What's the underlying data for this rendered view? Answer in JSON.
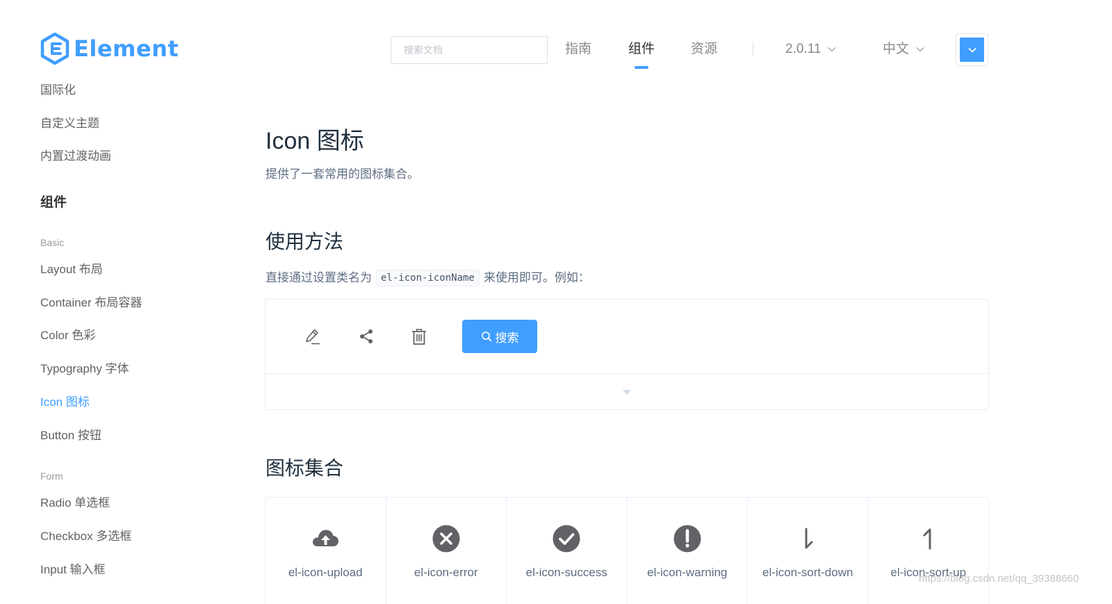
{
  "logo": {
    "text": "Element"
  },
  "header": {
    "search_placeholder": "搜索文档",
    "nav": [
      "指南",
      "组件",
      "资源"
    ],
    "version": "2.0.11",
    "language": "中文",
    "theme_color": "#409eff"
  },
  "sidebar": {
    "top_items": [
      "国际化",
      "自定义主题",
      "内置过渡动画"
    ],
    "heading": "组件",
    "groups": [
      {
        "title": "Basic",
        "items": [
          "Layout 布局",
          "Container 布局容器",
          "Color 色彩",
          "Typography 字体",
          "Icon 图标",
          "Button 按钮"
        ]
      },
      {
        "title": "Form",
        "items": [
          "Radio 单选框",
          "Checkbox 多选框",
          "Input 输入框"
        ]
      }
    ],
    "active_item": "Icon 图标"
  },
  "main": {
    "title": "Icon 图标",
    "description": "提供了一套常用的图标集合。",
    "usage_title": "使用方法",
    "usage_before": "直接通过设置类名为",
    "usage_code": "el-icon-iconName",
    "usage_after": "来使用即可。例如：",
    "demo": {
      "icons": [
        "edit-icon",
        "share-icon",
        "delete-icon"
      ],
      "button_label": "搜索"
    },
    "collection_title": "图标集合",
    "icon_list": [
      {
        "name": "el-icon-upload",
        "icon": "upload-icon"
      },
      {
        "name": "el-icon-error",
        "icon": "error-icon"
      },
      {
        "name": "el-icon-success",
        "icon": "success-icon"
      },
      {
        "name": "el-icon-warning",
        "icon": "warning-icon"
      },
      {
        "name": "el-icon-sort-down",
        "icon": "sort-down-icon"
      },
      {
        "name": "el-icon-sort-up",
        "icon": "sort-up-icon"
      }
    ]
  },
  "watermark": "https://blog.csdn.net/qq_39388660",
  "colors": {
    "accent": "#409eff",
    "text": "#5e6d82",
    "border": "#eaeefb"
  }
}
